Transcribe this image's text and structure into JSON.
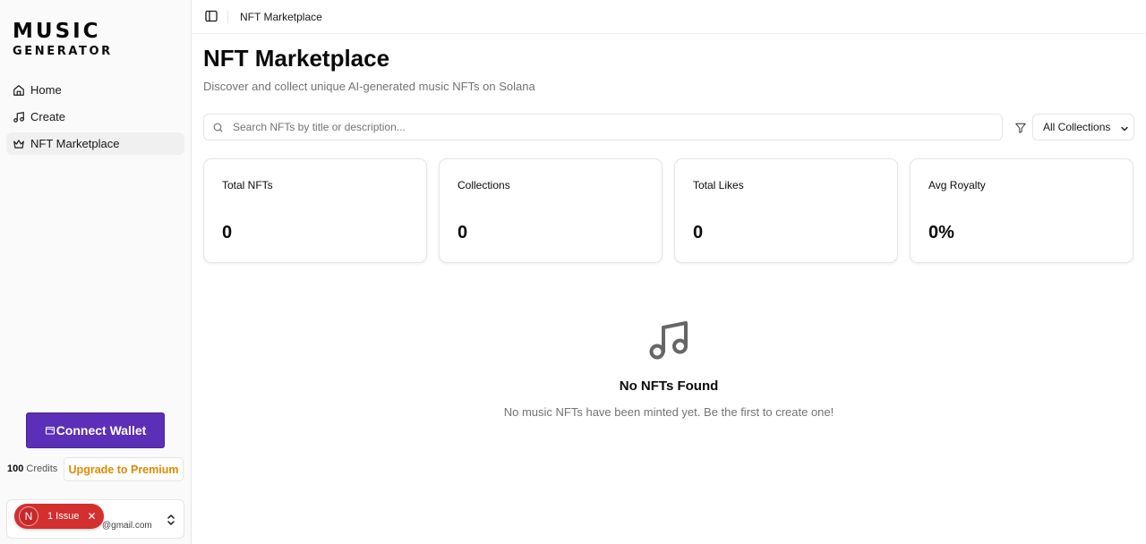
{
  "brand": {
    "line1": "MUSIC",
    "line2": "GENERATOR"
  },
  "sidebar": {
    "items": [
      {
        "label": "Home",
        "icon": "home-icon"
      },
      {
        "label": "Create",
        "icon": "music-note-icon"
      },
      {
        "label": "NFT Marketplace",
        "icon": "crown-icon",
        "active": true
      }
    ],
    "connect_wallet": "Connect Wallet",
    "credits_count": "100",
    "credits_label": "Credits",
    "upgrade_label": "Upgrade to Premium",
    "user_email": "@gmail.com",
    "issue": {
      "avatar": "N",
      "label": "1 Issue"
    }
  },
  "topbar": {
    "title": "NFT Marketplace"
  },
  "main": {
    "title": "NFT Marketplace",
    "subtitle": "Discover and collect unique AI-generated music NFTs on Solana",
    "search_placeholder": "Search NFTs by title or description...",
    "collection_filter": "All Collections",
    "stats": [
      {
        "label": "Total NFTs",
        "value": "0"
      },
      {
        "label": "Collections",
        "value": "0"
      },
      {
        "label": "Total Likes",
        "value": "0"
      },
      {
        "label": "Avg Royalty",
        "value": "0%"
      }
    ],
    "empty": {
      "title": "No NFTs Found",
      "description": "No music NFTs have been minted yet. Be the first to create one!"
    }
  },
  "colors": {
    "accent": "#5b2fb7",
    "upgrade_text": "#e08a00",
    "issue_badge": "#d32f2f"
  }
}
